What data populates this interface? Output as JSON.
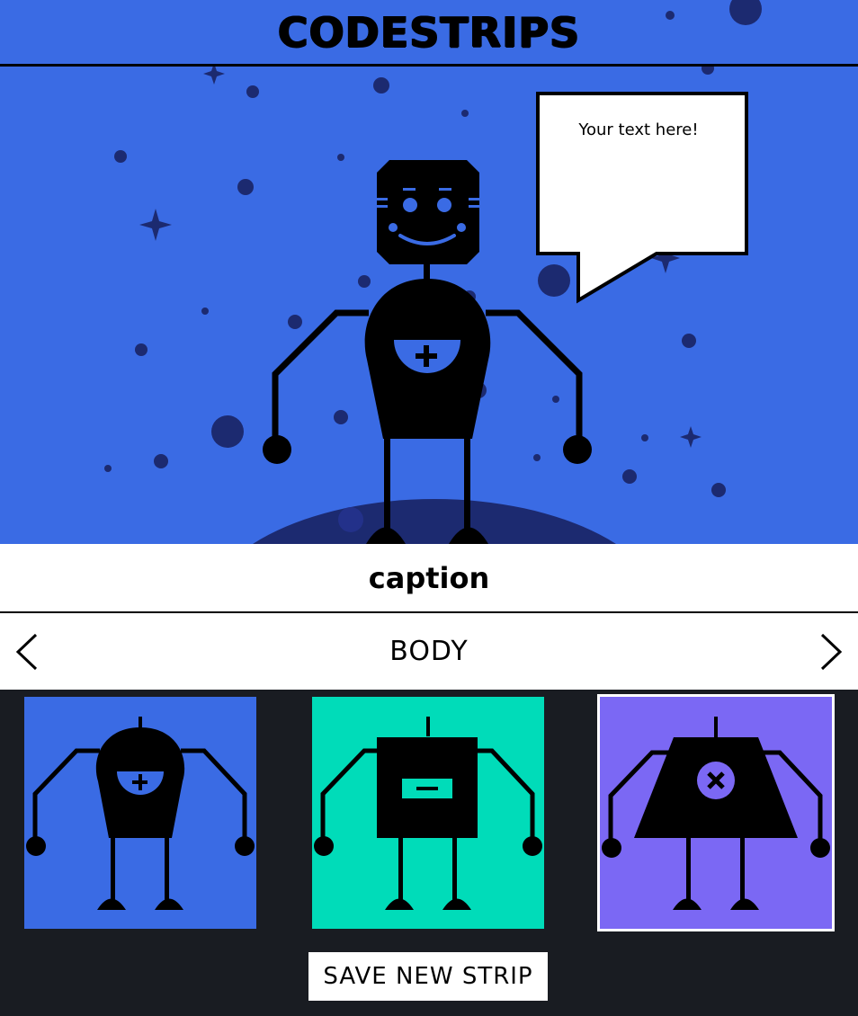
{
  "app": {
    "title": "CODESTRIPS"
  },
  "scene": {
    "bubble_text": "Your text here!"
  },
  "caption": {
    "text": "caption"
  },
  "picker": {
    "label": "BODY",
    "prev_icon": "chevron-left-icon",
    "next_icon": "chevron-right-icon"
  },
  "options": [
    {
      "name": "round-body",
      "color": "#3a6be4",
      "symbol": "plus"
    },
    {
      "name": "square-body",
      "color": "#00dcb9",
      "symbol": "minus"
    },
    {
      "name": "trapezoid-body",
      "color": "#7b68f4",
      "symbol": "times",
      "selected": true
    }
  ],
  "actions": {
    "save_label": "SAVE NEW STRIP"
  },
  "colors": {
    "sky": "#3a6be4",
    "dark": "#191c22",
    "star": "#1c2a70",
    "mint": "#00dcb9",
    "violet": "#7b68f4"
  }
}
